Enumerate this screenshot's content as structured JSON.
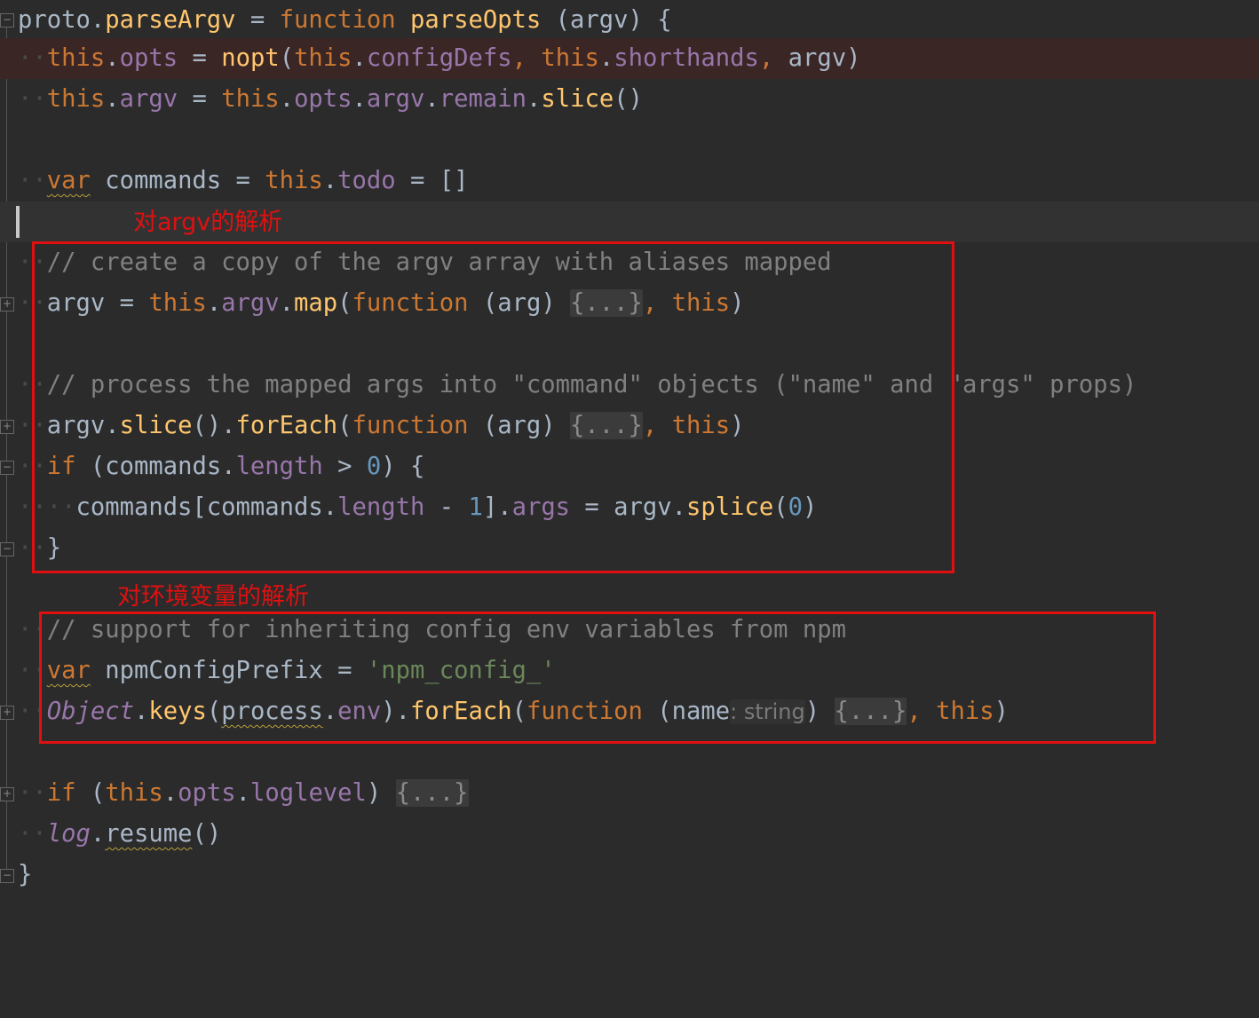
{
  "editor": {
    "theme": "darcula",
    "colors": {
      "background": "#2b2b2b",
      "keyword": "#cc7832",
      "function": "#ffc66d",
      "property": "#9876aa",
      "identifier": "#a9b7c6",
      "number": "#6897bb",
      "string": "#6a8759",
      "comment": "#808080",
      "annotation": "#e01010"
    },
    "lines": {
      "l1": [
        "proto",
        ".",
        "parseArgv",
        " = ",
        "function",
        " ",
        "parseOpts",
        " (argv) {"
      ],
      "l2": [
        "this",
        ".",
        "opts",
        " = ",
        "nopt",
        "(",
        "this",
        ".",
        "configDefs",
        ", ",
        "this",
        ".",
        "shorthands",
        ", ",
        "argv)"
      ],
      "l3": [
        "this",
        ".",
        "argv",
        " = ",
        "this",
        ".",
        "opts",
        ".",
        "argv",
        ".",
        "remain",
        ".",
        "slice",
        "()"
      ],
      "l5": [
        "var",
        " commands = ",
        "this",
        ".",
        "todo",
        " = []"
      ],
      "l7": "// create a copy of the argv array with aliases mapped",
      "l8": [
        "argv = ",
        "this",
        ".",
        "argv",
        ".",
        "map",
        "(",
        "function",
        " (arg) ",
        "{...}",
        ", ",
        "this",
        ")"
      ],
      "l10": "// process the mapped args into \"command\" objects (\"name\" and \"args\" props)",
      "l11": [
        "argv.",
        "slice",
        "().",
        "forEach",
        "(",
        "function",
        " (arg) ",
        "{...}",
        ", ",
        "this",
        ")"
      ],
      "l12": [
        "if",
        " (commands.",
        "length",
        " > ",
        "0",
        ") {"
      ],
      "l13": [
        "commands[commands.",
        "length",
        " - ",
        "1",
        "].",
        "args",
        " = argv.",
        "splice",
        "(",
        "0",
        ")"
      ],
      "l14": "}",
      "l16": "// support for inheriting config env variables from npm",
      "l17": [
        "var",
        " npmConfigPrefix = ",
        "'npm_config_'"
      ],
      "l18": [
        "Object",
        ".",
        "keys",
        "(",
        "process",
        ".",
        "env",
        ").",
        "forEach",
        "(",
        "function",
        " (name",
        ": string",
        ") ",
        "{...}",
        ", ",
        "this",
        ")"
      ],
      "l20": [
        "if",
        " (",
        "this",
        ".",
        "opts",
        ".",
        "loglevel",
        ") ",
        "{...}"
      ],
      "l21": [
        "log",
        ".",
        "resume",
        "()"
      ],
      "l22": "}"
    }
  },
  "annotations": {
    "argv_label": "对argv的解析",
    "env_label": "对环境变量的解析"
  }
}
